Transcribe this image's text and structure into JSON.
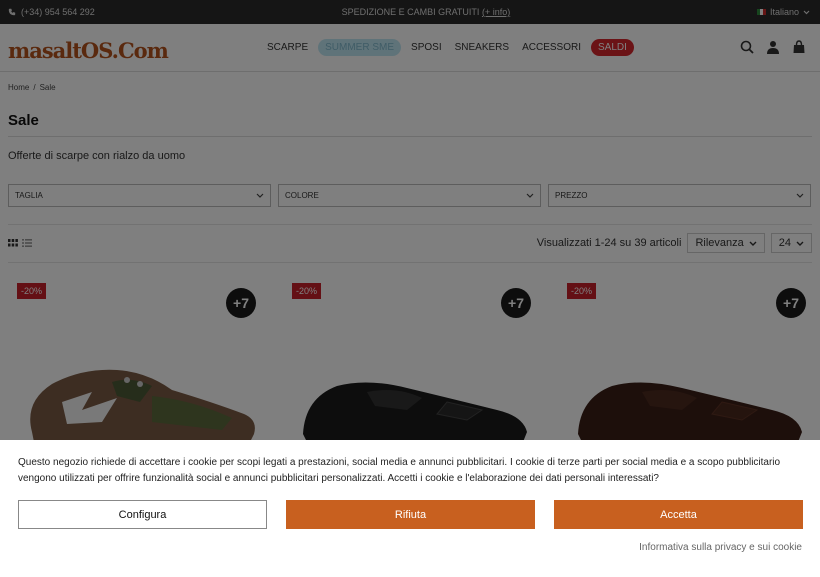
{
  "topbar": {
    "phone": "(+34) 954 564 292",
    "promo_text": "SPEDIZIONE E CAMBI GRATUITI",
    "promo_link": "(+ info)",
    "language": "Italiano"
  },
  "header": {
    "logo": "masaltOS.Com",
    "nav": [
      "SCARPE",
      "SUMMER SME",
      "SPOSI",
      "SNEAKERS",
      "ACCESSORI",
      "SALDI"
    ]
  },
  "breadcrumb": [
    "Home",
    "Sale"
  ],
  "page": {
    "title": "Sale",
    "subtitle": "Offerte di scarpe con rialzo da uomo"
  },
  "filters": [
    "TAGLIA",
    "COLORE",
    "PREZZO"
  ],
  "toolbar": {
    "results": "Visualizzati 1-24 su 39 articoli",
    "sort": "Rilevanza",
    "per_page": "24"
  },
  "products": [
    {
      "discount": "-20%",
      "height_badge": "+7"
    },
    {
      "discount": "-20%",
      "height_badge": "+7"
    },
    {
      "discount": "-20%",
      "height_badge": "+7"
    }
  ],
  "cookie": {
    "message": "Questo negozio richiede di accettare i cookie per scopi legati a prestazioni, social media e annunci pubblicitari. I cookie di terze parti per social media e a scopo pubblicitario vengono utilizzati per offrire funzionalità social e annunci pubblicitari personalizzati. Accetti i cookie e l'elaborazione dei dati personali interessati?",
    "configure": "Configura",
    "reject": "Rifiuta",
    "accept": "Accetta",
    "privacy_link": "Informativa sulla privacy e sui cookie"
  },
  "colors": {
    "brand": "#b4531d",
    "button": "#c8601f",
    "sale": "#d6262c"
  }
}
